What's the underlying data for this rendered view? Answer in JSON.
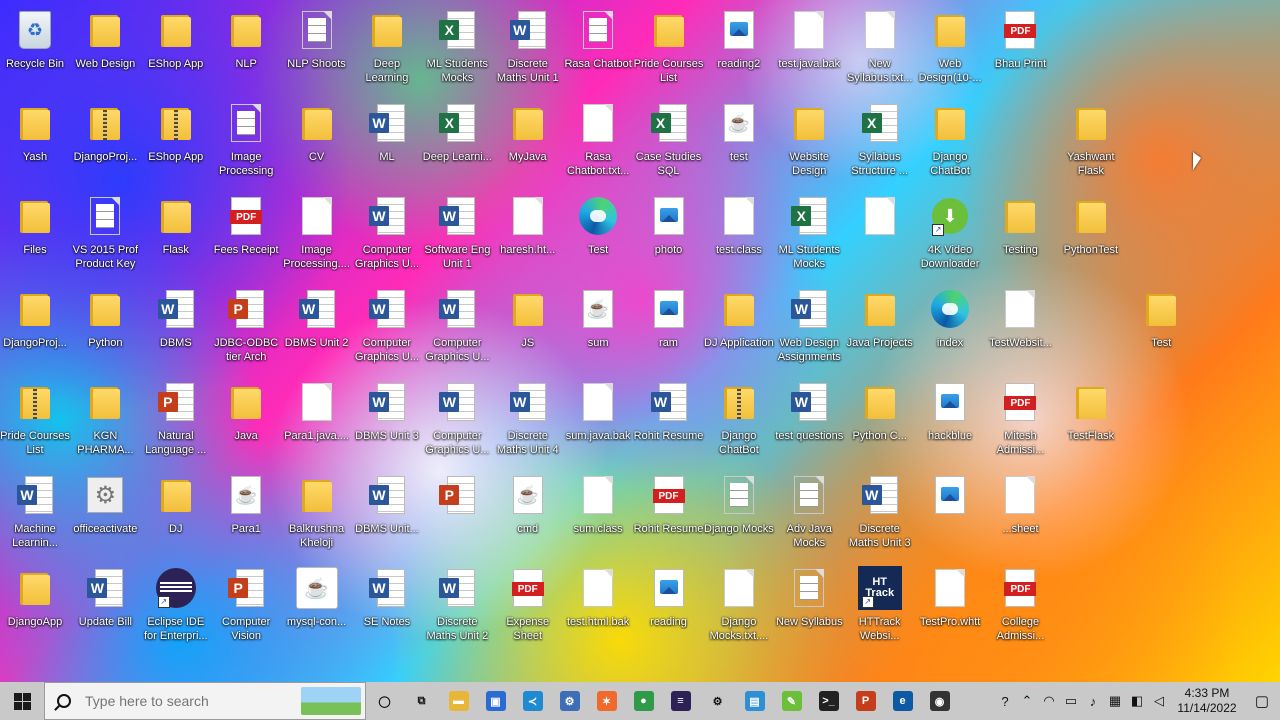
{
  "desktop": {
    "icons": [
      {
        "label": "Recycle Bin",
        "type": "recycle"
      },
      {
        "label": "Web Design",
        "type": "folder"
      },
      {
        "label": "EShop App",
        "type": "folder"
      },
      {
        "label": "NLP",
        "type": "folder"
      },
      {
        "label": "NLP Shoots",
        "type": "doc-lines"
      },
      {
        "label": "Deep Learning",
        "type": "folder"
      },
      {
        "label": "ML Students Mocks",
        "type": "excel"
      },
      {
        "label": "Discrete Maths Unit 1",
        "type": "word"
      },
      {
        "label": "Rasa Chatbot",
        "type": "doc-lines"
      },
      {
        "label": "Pride Courses List",
        "type": "folder"
      },
      {
        "label": "reading2",
        "type": "image"
      },
      {
        "label": "test.java.bak",
        "type": "doc"
      },
      {
        "label": "New Syllabus.txt...",
        "type": "doc"
      },
      {
        "label": "Web Design(10-...",
        "type": "folder"
      },
      {
        "label": "Bhau Print",
        "type": "pdf"
      },
      {
        "label": "",
        "type": "empty"
      },
      {
        "label": "",
        "type": "empty"
      },
      {
        "label": "",
        "type": "empty"
      },
      {
        "label": "Yash",
        "type": "folder"
      },
      {
        "label": "DjangoProj...",
        "type": "zip"
      },
      {
        "label": "EShop App",
        "type": "zip"
      },
      {
        "label": "Image Processing",
        "type": "doc-lines"
      },
      {
        "label": "CV",
        "type": "folder"
      },
      {
        "label": "ML",
        "type": "word"
      },
      {
        "label": "Deep Learni...",
        "type": "excel"
      },
      {
        "label": "MyJava",
        "type": "folder"
      },
      {
        "label": "Rasa Chatbot.txt...",
        "type": "doc"
      },
      {
        "label": "Case Studies SQL",
        "type": "excel"
      },
      {
        "label": "test",
        "type": "java"
      },
      {
        "label": "Website Design",
        "type": "folder"
      },
      {
        "label": "Syllabus Structure ...",
        "type": "excel"
      },
      {
        "label": "Django ChatBot",
        "type": "folder"
      },
      {
        "label": "",
        "type": "empty"
      },
      {
        "label": "Yashwant Flask",
        "type": "folder"
      },
      {
        "label": "",
        "type": "empty"
      },
      {
        "label": "",
        "type": "empty"
      },
      {
        "label": "Files",
        "type": "folder"
      },
      {
        "label": "VS 2015 Prof Product Key",
        "type": "doc-lines"
      },
      {
        "label": "Flask",
        "type": "folder"
      },
      {
        "label": "Fees Receipt",
        "type": "pdf"
      },
      {
        "label": "Image Processing....",
        "type": "doc"
      },
      {
        "label": "Computer Graphics U...",
        "type": "word"
      },
      {
        "label": "Software Eng Unit 1",
        "type": "word"
      },
      {
        "label": "haresh.ht...",
        "type": "doc"
      },
      {
        "label": "Test",
        "type": "edge"
      },
      {
        "label": "photo",
        "type": "image"
      },
      {
        "label": "test.class",
        "type": "doc"
      },
      {
        "label": "ML Students Mocks",
        "type": "excel"
      },
      {
        "label": "",
        "type": "doc"
      },
      {
        "label": "4K Video Downloader",
        "type": "ccm"
      },
      {
        "label": "Testing",
        "type": "folder"
      },
      {
        "label": "PythonTest",
        "type": "folder"
      },
      {
        "label": "",
        "type": "empty"
      },
      {
        "label": "",
        "type": "empty"
      },
      {
        "label": "DjangoProj...",
        "type": "folder"
      },
      {
        "label": "Python",
        "type": "folder"
      },
      {
        "label": "DBMS",
        "type": "word"
      },
      {
        "label": "JDBC-ODBC tier Arch",
        "type": "ppt"
      },
      {
        "label": "DBMS Unit 2",
        "type": "word"
      },
      {
        "label": "Computer Graphics U...",
        "type": "word"
      },
      {
        "label": "Computer Graphics U...",
        "type": "word"
      },
      {
        "label": "JS",
        "type": "folder"
      },
      {
        "label": "sum",
        "type": "java"
      },
      {
        "label": "ram",
        "type": "image"
      },
      {
        "label": "DJ Application",
        "type": "folder"
      },
      {
        "label": "Web Design Assignments",
        "type": "word"
      },
      {
        "label": "Java Projects",
        "type": "folder"
      },
      {
        "label": "index",
        "type": "edge"
      },
      {
        "label": "TestWebsit...",
        "type": "doc"
      },
      {
        "label": "",
        "type": "empty"
      },
      {
        "label": "Test",
        "type": "folder"
      },
      {
        "label": "",
        "type": "empty"
      },
      {
        "label": "Pride Courses List",
        "type": "zip"
      },
      {
        "label": "KGN PHARMA...",
        "type": "folder"
      },
      {
        "label": "Natural Language ...",
        "type": "ppt"
      },
      {
        "label": "Java",
        "type": "folder"
      },
      {
        "label": "Para1.java....",
        "type": "doc"
      },
      {
        "label": "DBMS Unit 3",
        "type": "word"
      },
      {
        "label": "Computer Graphics U...",
        "type": "word"
      },
      {
        "label": "Discrete Maths Unit 4",
        "type": "word"
      },
      {
        "label": "sum.java.bak",
        "type": "doc"
      },
      {
        "label": "Rohit Resume",
        "type": "word"
      },
      {
        "label": "Django ChatBot",
        "type": "zip"
      },
      {
        "label": "test questions",
        "type": "word"
      },
      {
        "label": "Python C...",
        "type": "folder"
      },
      {
        "label": "hackblue",
        "type": "image"
      },
      {
        "label": "Mitesh Admissi...",
        "type": "pdf"
      },
      {
        "label": "TestFlask",
        "type": "folder"
      },
      {
        "label": "",
        "type": "empty"
      },
      {
        "label": "",
        "type": "empty"
      },
      {
        "label": "Machine Learnin...",
        "type": "word"
      },
      {
        "label": "officeactivate",
        "type": "gear"
      },
      {
        "label": "DJ",
        "type": "folder"
      },
      {
        "label": "Para1",
        "type": "java"
      },
      {
        "label": "Balkrushna Kheloji",
        "type": "folder"
      },
      {
        "label": "DBMS Unit...",
        "type": "word"
      },
      {
        "label": "",
        "type": "ppt"
      },
      {
        "label": "cmd",
        "type": "java"
      },
      {
        "label": "sum.class",
        "type": "doc"
      },
      {
        "label": "Rohit Resume",
        "type": "pdf"
      },
      {
        "label": "Django Mocks",
        "type": "doc-lines"
      },
      {
        "label": "Adv Java Mocks",
        "type": "doc-lines"
      },
      {
        "label": "Discrete Maths Unit 3",
        "type": "word"
      },
      {
        "label": "",
        "type": "image"
      },
      {
        "label": "...sheet",
        "type": "doc"
      },
      {
        "label": "",
        "type": "empty"
      },
      {
        "label": "",
        "type": "empty"
      },
      {
        "label": "",
        "type": "empty"
      },
      {
        "label": "DjangoApp",
        "type": "folder"
      },
      {
        "label": "Update Bill",
        "type": "word"
      },
      {
        "label": "Eclipse IDE for Enterpri...",
        "type": "eclipse"
      },
      {
        "label": "Computer Vision",
        "type": "ppt"
      },
      {
        "label": "mysql-con...",
        "type": "jar"
      },
      {
        "label": "SE Notes",
        "type": "word"
      },
      {
        "label": "Discrete Maths Unit 2",
        "type": "word"
      },
      {
        "label": "Expense Sheet",
        "type": "pdf"
      },
      {
        "label": "test.html.bak",
        "type": "doc"
      },
      {
        "label": "reading",
        "type": "image"
      },
      {
        "label": "Django Mocks.txt....",
        "type": "doc"
      },
      {
        "label": "New Syllabus",
        "type": "doc-lines"
      },
      {
        "label": "HTTrack Websi...",
        "type": "httrack"
      },
      {
        "label": "TestPro.whtt",
        "type": "doc"
      },
      {
        "label": "College Admissi...",
        "type": "pdf"
      },
      {
        "label": "",
        "type": "empty"
      },
      {
        "label": "",
        "type": "empty"
      },
      {
        "label": "",
        "type": "empty"
      }
    ]
  },
  "taskbar": {
    "search_placeholder": "Type here to search",
    "apps": [
      {
        "name": "task-view",
        "glyph": "◯",
        "color": "transparent"
      },
      {
        "name": "multitask",
        "glyph": "⧉",
        "color": "transparent"
      },
      {
        "name": "file-explorer",
        "glyph": "▬",
        "color": "#e8b73a"
      },
      {
        "name": "store",
        "glyph": "▣",
        "color": "#2a6bd3"
      },
      {
        "name": "vscode",
        "glyph": "≺",
        "color": "#1f8ad2"
      },
      {
        "name": "anaconda",
        "glyph": "⚙",
        "color": "#3e6fb6"
      },
      {
        "name": "postman",
        "glyph": "✶",
        "color": "#ef6a2c"
      },
      {
        "name": "chrome",
        "glyph": "●",
        "color": "#2f9b46"
      },
      {
        "name": "eclipse",
        "glyph": "≡",
        "color": "#2c2255"
      },
      {
        "name": "settings",
        "glyph": "⚙",
        "color": "transparent"
      },
      {
        "name": "remote",
        "glyph": "▤",
        "color": "#2d8fd6"
      },
      {
        "name": "notepad",
        "glyph": "✎",
        "color": "#6bbf3a"
      },
      {
        "name": "terminal",
        "glyph": ">_",
        "color": "#222222"
      },
      {
        "name": "powerpoint",
        "glyph": "P",
        "color": "#c43e1c"
      },
      {
        "name": "edge",
        "glyph": "e",
        "color": "#0c59a4"
      },
      {
        "name": "obs",
        "glyph": "◉",
        "color": "#333333"
      }
    ],
    "time": "4:33 PM",
    "date": "11/14/2022"
  }
}
